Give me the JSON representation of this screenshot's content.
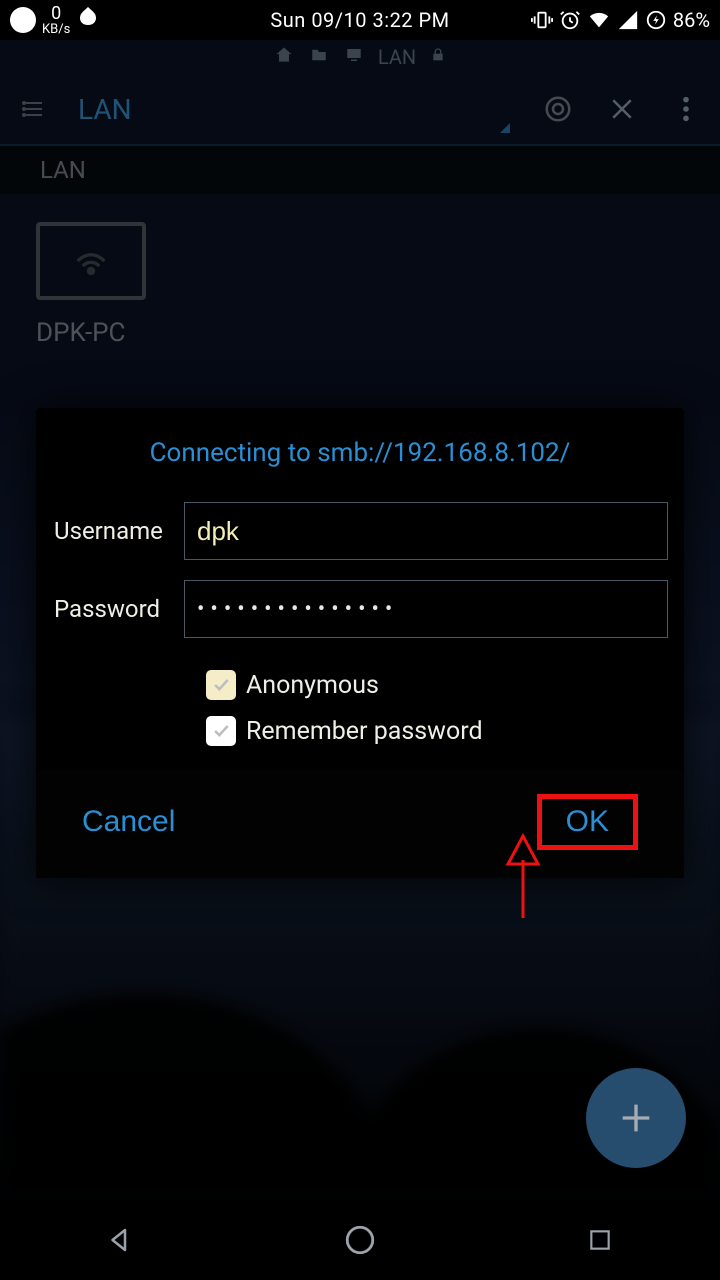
{
  "status": {
    "kbs_value": "0",
    "kbs_unit": "KB/s",
    "datetime": "Sun 09/10 3:22 PM",
    "battery_pct": "86%"
  },
  "path": {
    "segment": "LAN"
  },
  "toolbar": {
    "title": "LAN"
  },
  "crumb": {
    "label": "LAN"
  },
  "device": {
    "name": "DPK-PC"
  },
  "dialog": {
    "title": "Connecting to smb://192.168.8.102/",
    "username_label": "Username",
    "username_value": "dpk",
    "password_label": "Password",
    "password_masked": "•••••••••••••••",
    "anonymous_label": "Anonymous",
    "remember_label": "Remember password",
    "cancel_label": "Cancel",
    "ok_label": "OK"
  }
}
